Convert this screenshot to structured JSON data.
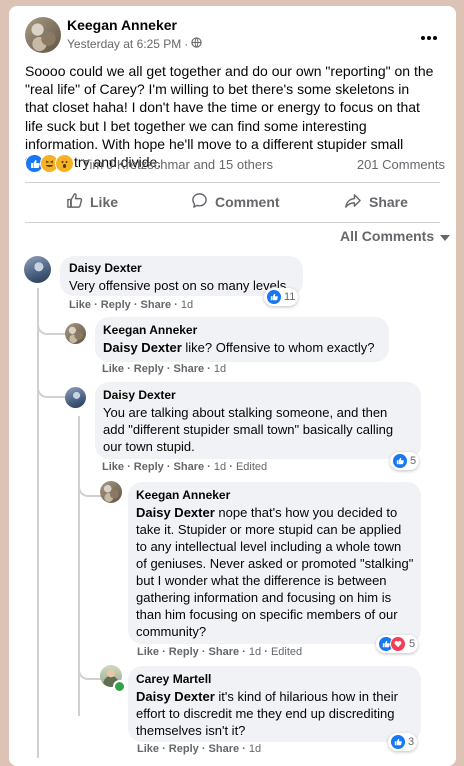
{
  "post": {
    "author": "Keegan Anneker",
    "time": "Yesterday at 6:25 PM",
    "dot": "·",
    "text": "Soooo could we all get together and do our own \"reporting\" on the \"real life\" of Carey? I'm willing to bet there's some skeletons in that closet haha! I don't have the time or energy to focus on that life suck but I bet together we can find some interesting information. With hope he'll move to a different stupider small town to try and divide.",
    "reactions_text": "Tim J Kretzschmar and 15 others",
    "comments_count": "201 Comments",
    "actions": {
      "like": "Like",
      "comment": "Comment",
      "share": "Share"
    },
    "sort": "All Comments"
  },
  "comments": [
    {
      "author": "Daisy Dexter",
      "text": "Very offensive post on so many levels",
      "actions": {
        "like": "Like",
        "reply": "Reply",
        "share": "Share",
        "time": "1d"
      },
      "reaction_count": "11"
    },
    {
      "author": "Keegan Anneker",
      "tag": "Daisy Dexter",
      "text": " like? Offensive to whom exactly?",
      "actions": {
        "like": "Like",
        "reply": "Reply",
        "share": "Share",
        "time": "1d"
      }
    },
    {
      "author": "Daisy Dexter",
      "text": "You are talking about stalking someone, and then add \"different stupider small town\" basically calling our town stupid.",
      "actions": {
        "like": "Like",
        "reply": "Reply",
        "share": "Share",
        "time": "1d",
        "edited": "Edited"
      },
      "reaction_count": "5"
    },
    {
      "author": "Keegan Anneker",
      "tag": "Daisy Dexter",
      "text": " nope that's how you decided to take it. Stupider or more stupid can be applied to any intellectual level including a whole town of geniuses. Never asked or promoted \"stalking\" but I wonder what the difference is between gathering information and focusing on him is than him focusing on specific members of our community?",
      "actions": {
        "like": "Like",
        "reply": "Reply",
        "share": "Share",
        "time": "1d",
        "edited": "Edited"
      },
      "reaction_count": "5"
    },
    {
      "author": "Carey Martell",
      "tag": "Daisy Dexter",
      "text": " it's kind of hilarious how in their effort to discredit me they end up discrediting themselves isn't it?",
      "actions": {
        "like": "Like",
        "reply": "Reply",
        "share": "Share",
        "time": "1d"
      },
      "reaction_count": "3"
    }
  ],
  "colors": {
    "accent": "#1877f2",
    "love": "#f33e58",
    "haha": "#f7b125",
    "background": "#dcc3b6"
  },
  "icons": [
    "more-icon",
    "globe-icon",
    "like-icon",
    "comment-icon",
    "share-icon",
    "chevron-down-icon",
    "like-reaction-icon",
    "haha-reaction-icon",
    "wow-reaction-icon",
    "love-reaction-icon"
  ]
}
